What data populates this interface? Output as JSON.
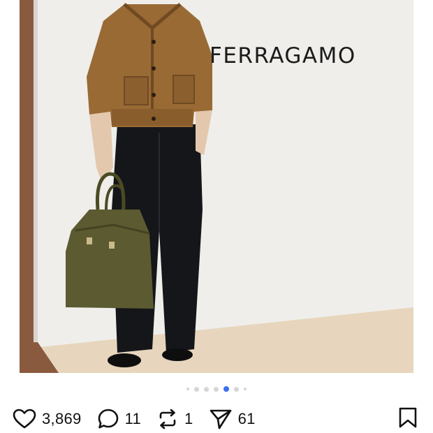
{
  "post": {
    "image_text": "FERRAGAMO",
    "carousel": {
      "total": 7,
      "active_index": 4
    }
  },
  "actions": {
    "like_count": "3,869",
    "reply_count": "11",
    "repost_count": "1",
    "share_count": "61"
  },
  "icons": {
    "like": "heart-icon",
    "reply": "comment-icon",
    "repost": "repost-icon",
    "share": "send-icon",
    "save": "bookmark-icon"
  },
  "colors": {
    "active_dot": "#3a6ff0",
    "inactive_dot": "#d6d6d6",
    "text": "#111111"
  }
}
